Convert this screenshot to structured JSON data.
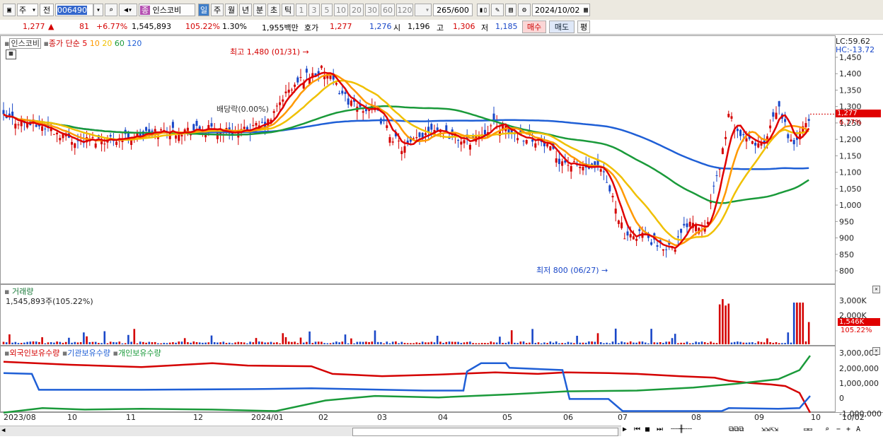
{
  "toolbar": {
    "market_type": "주",
    "view_type": "전",
    "stock_code": "006490",
    "stock_name": "인스코비",
    "stock_badge": "종",
    "periods": [
      "일",
      "주",
      "월",
      "년",
      "분",
      "초",
      "틱"
    ],
    "intervals": [
      "1",
      "3",
      "5",
      "10",
      "20",
      "30",
      "60",
      "120"
    ],
    "count_display": "265/600",
    "date": "2024/10/02"
  },
  "quote": {
    "price": "1,277",
    "change": "81",
    "change_pct": "+6.77%",
    "volume": "1,545,893",
    "volume_ratio": "105.22%",
    "turnover": "1.30%",
    "amount": "1,955백만",
    "bid_label": "호가",
    "ask_price": "1,277",
    "bid_price": "1,276",
    "open_label": "시",
    "open": "1,196",
    "high_label": "고",
    "high": "1,306",
    "low_label": "저",
    "low": "1,185",
    "buy_button": "매수",
    "sell_button": "매도",
    "eval_button": "평"
  },
  "price_panel": {
    "legend_name": "인스코비",
    "legend_ma_label": "종가 단순",
    "ma_periods": [
      {
        "label": "5",
        "color": "#e00000"
      },
      {
        "label": "10",
        "color": "#ff9900"
      },
      {
        "label": "20",
        "color": "#f0c000"
      },
      {
        "label": "60",
        "color": "#1a9a3a"
      },
      {
        "label": "120",
        "color": "#1f5fd6"
      }
    ],
    "y_ticks": [
      "1,450",
      "1,400",
      "1,350",
      "1,300",
      "1,250",
      "1,200",
      "1,150",
      "1,100",
      "1,050",
      "1,000",
      "950",
      "900",
      "850",
      "800"
    ],
    "lc_label": "LC:59.62",
    "hc_label": "HC:-13.72",
    "current_price_label": "1,277",
    "current_change_label": "6.77%",
    "high_annotation": "최고 1,480 (01/31)",
    "low_annotation": "최저 800 (06/27)",
    "dividend_annotation": "배당락(0.00%)"
  },
  "volume_panel": {
    "title": "거래량",
    "value_label": "1,545,893주(105.22%)",
    "y_ticks": [
      "3,000K",
      "2,000K"
    ],
    "current_label": "1,546K",
    "current_pct": "105.22%"
  },
  "holdings_panel": {
    "series": [
      {
        "name": "외국인보유수량",
        "color": "#d40000"
      },
      {
        "name": "기관보유수량",
        "color": "#1f5fd6"
      },
      {
        "name": "개인보유수량",
        "color": "#1a9a3a"
      }
    ],
    "y_ticks": [
      "3,000,000",
      "2,000,000",
      "1,000,000",
      "0",
      "-1,000,000"
    ]
  },
  "x_axis": {
    "labels": [
      "2023/08",
      "10",
      "11",
      "12",
      "2024/01",
      "02",
      "03",
      "04",
      "05",
      "06",
      "07",
      "08",
      "09",
      "10"
    ],
    "last_date": "10/02"
  },
  "colors": {
    "up": "#d40000",
    "down": "#1947c8",
    "ma5": "#e00000",
    "ma10": "#ff9900",
    "ma20": "#f0c000",
    "ma60": "#1a9a3a",
    "ma120": "#1f5fd6",
    "selected": "#3f7ec9"
  }
}
